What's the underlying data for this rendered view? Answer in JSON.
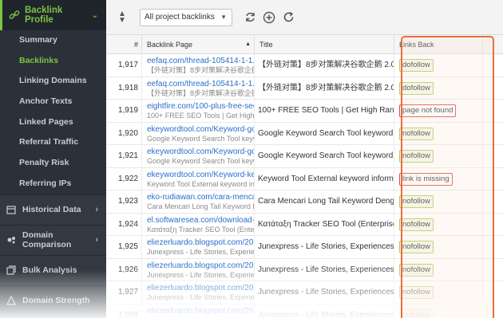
{
  "sidebar": {
    "header": {
      "label": "Backlink Profile",
      "icon": "link-icon"
    },
    "items": [
      {
        "label": "Summary",
        "active": false
      },
      {
        "label": "Backlinks",
        "active": true
      },
      {
        "label": "Linking Domains",
        "active": false
      },
      {
        "label": "Anchor Texts",
        "active": false
      },
      {
        "label": "Linked Pages",
        "active": false
      },
      {
        "label": "Referral Traffic",
        "active": false
      },
      {
        "label": "Penalty Risk",
        "active": false
      },
      {
        "label": "Referring IPs",
        "active": false
      }
    ],
    "groups": [
      {
        "label": "Historical Data",
        "icon": "calendar-icon"
      },
      {
        "label": "Domain Comparison",
        "icon": "compare-icon"
      },
      {
        "label": "Bulk Analysis",
        "icon": "bulk-icon"
      },
      {
        "label": "Domain Strength",
        "icon": "strength-icon"
      }
    ]
  },
  "toolbar": {
    "filter_value": "All project backlinks"
  },
  "table": {
    "headers": {
      "num": "#",
      "page": "Backlink Page",
      "title": "Title",
      "links": "Links Back"
    },
    "rows": [
      {
        "num": "1,917",
        "url": "eefaq.com/thread-105414-1-1...",
        "sub": "【外链对策】8步对策解决谷歌企鹅",
        "title": "【外链对策】8步对策解决谷歌企鹅 2.0升...",
        "status": "dofollow",
        "bad": false
      },
      {
        "num": "1,918",
        "url": "eefaq.com/thread-105414-1-1...",
        "sub": "【外链对策】8步对策解决谷歌企鹅",
        "title": "【外链对策】8步对策解决谷歌企鹅 2.0升...",
        "status": "dofollow",
        "bad": false
      },
      {
        "num": "1,919",
        "url": "eightfire.com/100-plus-free-seo...",
        "sub": "100+ FREE SEO Tools | Get High R...",
        "title": "100+ FREE SEO Tools | Get High Rank |...",
        "status": "page not found",
        "bad": true
      },
      {
        "num": "1,920",
        "url": "ekeywordtool.com/Keyword-go...",
        "sub": "Google Keyword Search Tool keyw...",
        "title": "Google Keyword Search Tool keyword in...",
        "status": "nofollow",
        "bad": false
      },
      {
        "num": "1,921",
        "url": "ekeywordtool.com/Keyword-go...",
        "sub": "Google Keyword Search Tool keyw...",
        "title": "Google Keyword Search Tool keyword in...",
        "status": "nofollow",
        "bad": false
      },
      {
        "num": "1,922",
        "url": "ekeywordtool.com/Keyword-key...",
        "sub": "Keyword Tool External keyword inf...",
        "title": "Keyword Tool External keyword informati...",
        "status": "link is missing",
        "bad": true
      },
      {
        "num": "1,923",
        "url": "eko-rudiawan.com/cara-mencari...",
        "sub": "Cara Mencari Long Tail Keyword D...",
        "title": "Cara Mencari Long Tail Keyword Denga...",
        "status": "nofollow",
        "bad": false
      },
      {
        "num": "1,924",
        "url": "el.softwaresea.com/download-...",
        "sub": "Κατάταξη Tracker SEO Tool (Enterp...",
        "title": "Κατάταξη Tracker SEO Tool (Enterprise ...",
        "status": "nofollow",
        "bad": false
      },
      {
        "num": "1,925",
        "url": "eliezerluardo.blogspot.com/201...",
        "sub": "Junexpress - Life Stories, Experien...",
        "title": "Junexpress - Life Stories, Experiences a...",
        "status": "nofollow",
        "bad": false
      },
      {
        "num": "1,926",
        "url": "eliezerluardo.blogspot.com/201...",
        "sub": "Junexpress - Life Stories, Experien...",
        "title": "Junexpress - Life Stories, Experiences a...",
        "status": "nofollow",
        "bad": false
      },
      {
        "num": "1,927",
        "url": "eliezerluardo.blogspot.com/201...",
        "sub": "Junexpress - Life Stories, Experien...",
        "title": "Junexpress - Life Stories, Experiences a...",
        "status": "nofollow",
        "bad": false
      },
      {
        "num": "1,928",
        "url": "eliezerluardo.blogspot.com/201...",
        "sub": "Junexpress - Life Stories, Experien...",
        "title": "Junexpress - Life Stories, Experiences a...",
        "status": "nofollow",
        "bad": false
      }
    ]
  },
  "colors": {
    "accent_green": "#7cc442",
    "highlight_orange": "#e8703a",
    "link_blue": "#2a6fc9",
    "error_red": "#e24a3b"
  }
}
